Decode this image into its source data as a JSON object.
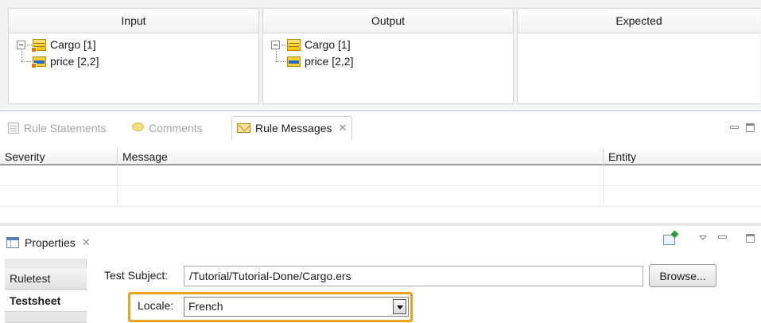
{
  "test_table": {
    "columns": [
      "Input",
      "Output",
      "Expected"
    ],
    "input_tree": {
      "root": "Cargo [1]",
      "child": "price [2,2]"
    },
    "output_tree": {
      "root": "Cargo [1]",
      "child": "price [2,2]"
    }
  },
  "messages_view": {
    "tabs": [
      "Rule Statements",
      "Comments",
      "Rule Messages"
    ],
    "active_tab": "Rule Messages",
    "columns": [
      "Severity",
      "Message",
      "Entity"
    ]
  },
  "properties_view": {
    "title": "Properties",
    "side_tabs": [
      "Ruletest",
      "Testsheet"
    ],
    "selected_side_tab": "Testsheet",
    "test_subject_label": "Test Subject:",
    "test_subject_value": "/Tutorial/Tutorial-Done/Cargo.ers",
    "browse_label": "Browse...",
    "locale_label": "Locale:",
    "locale_value": "French",
    "highlight_color": "#f0a21e"
  }
}
